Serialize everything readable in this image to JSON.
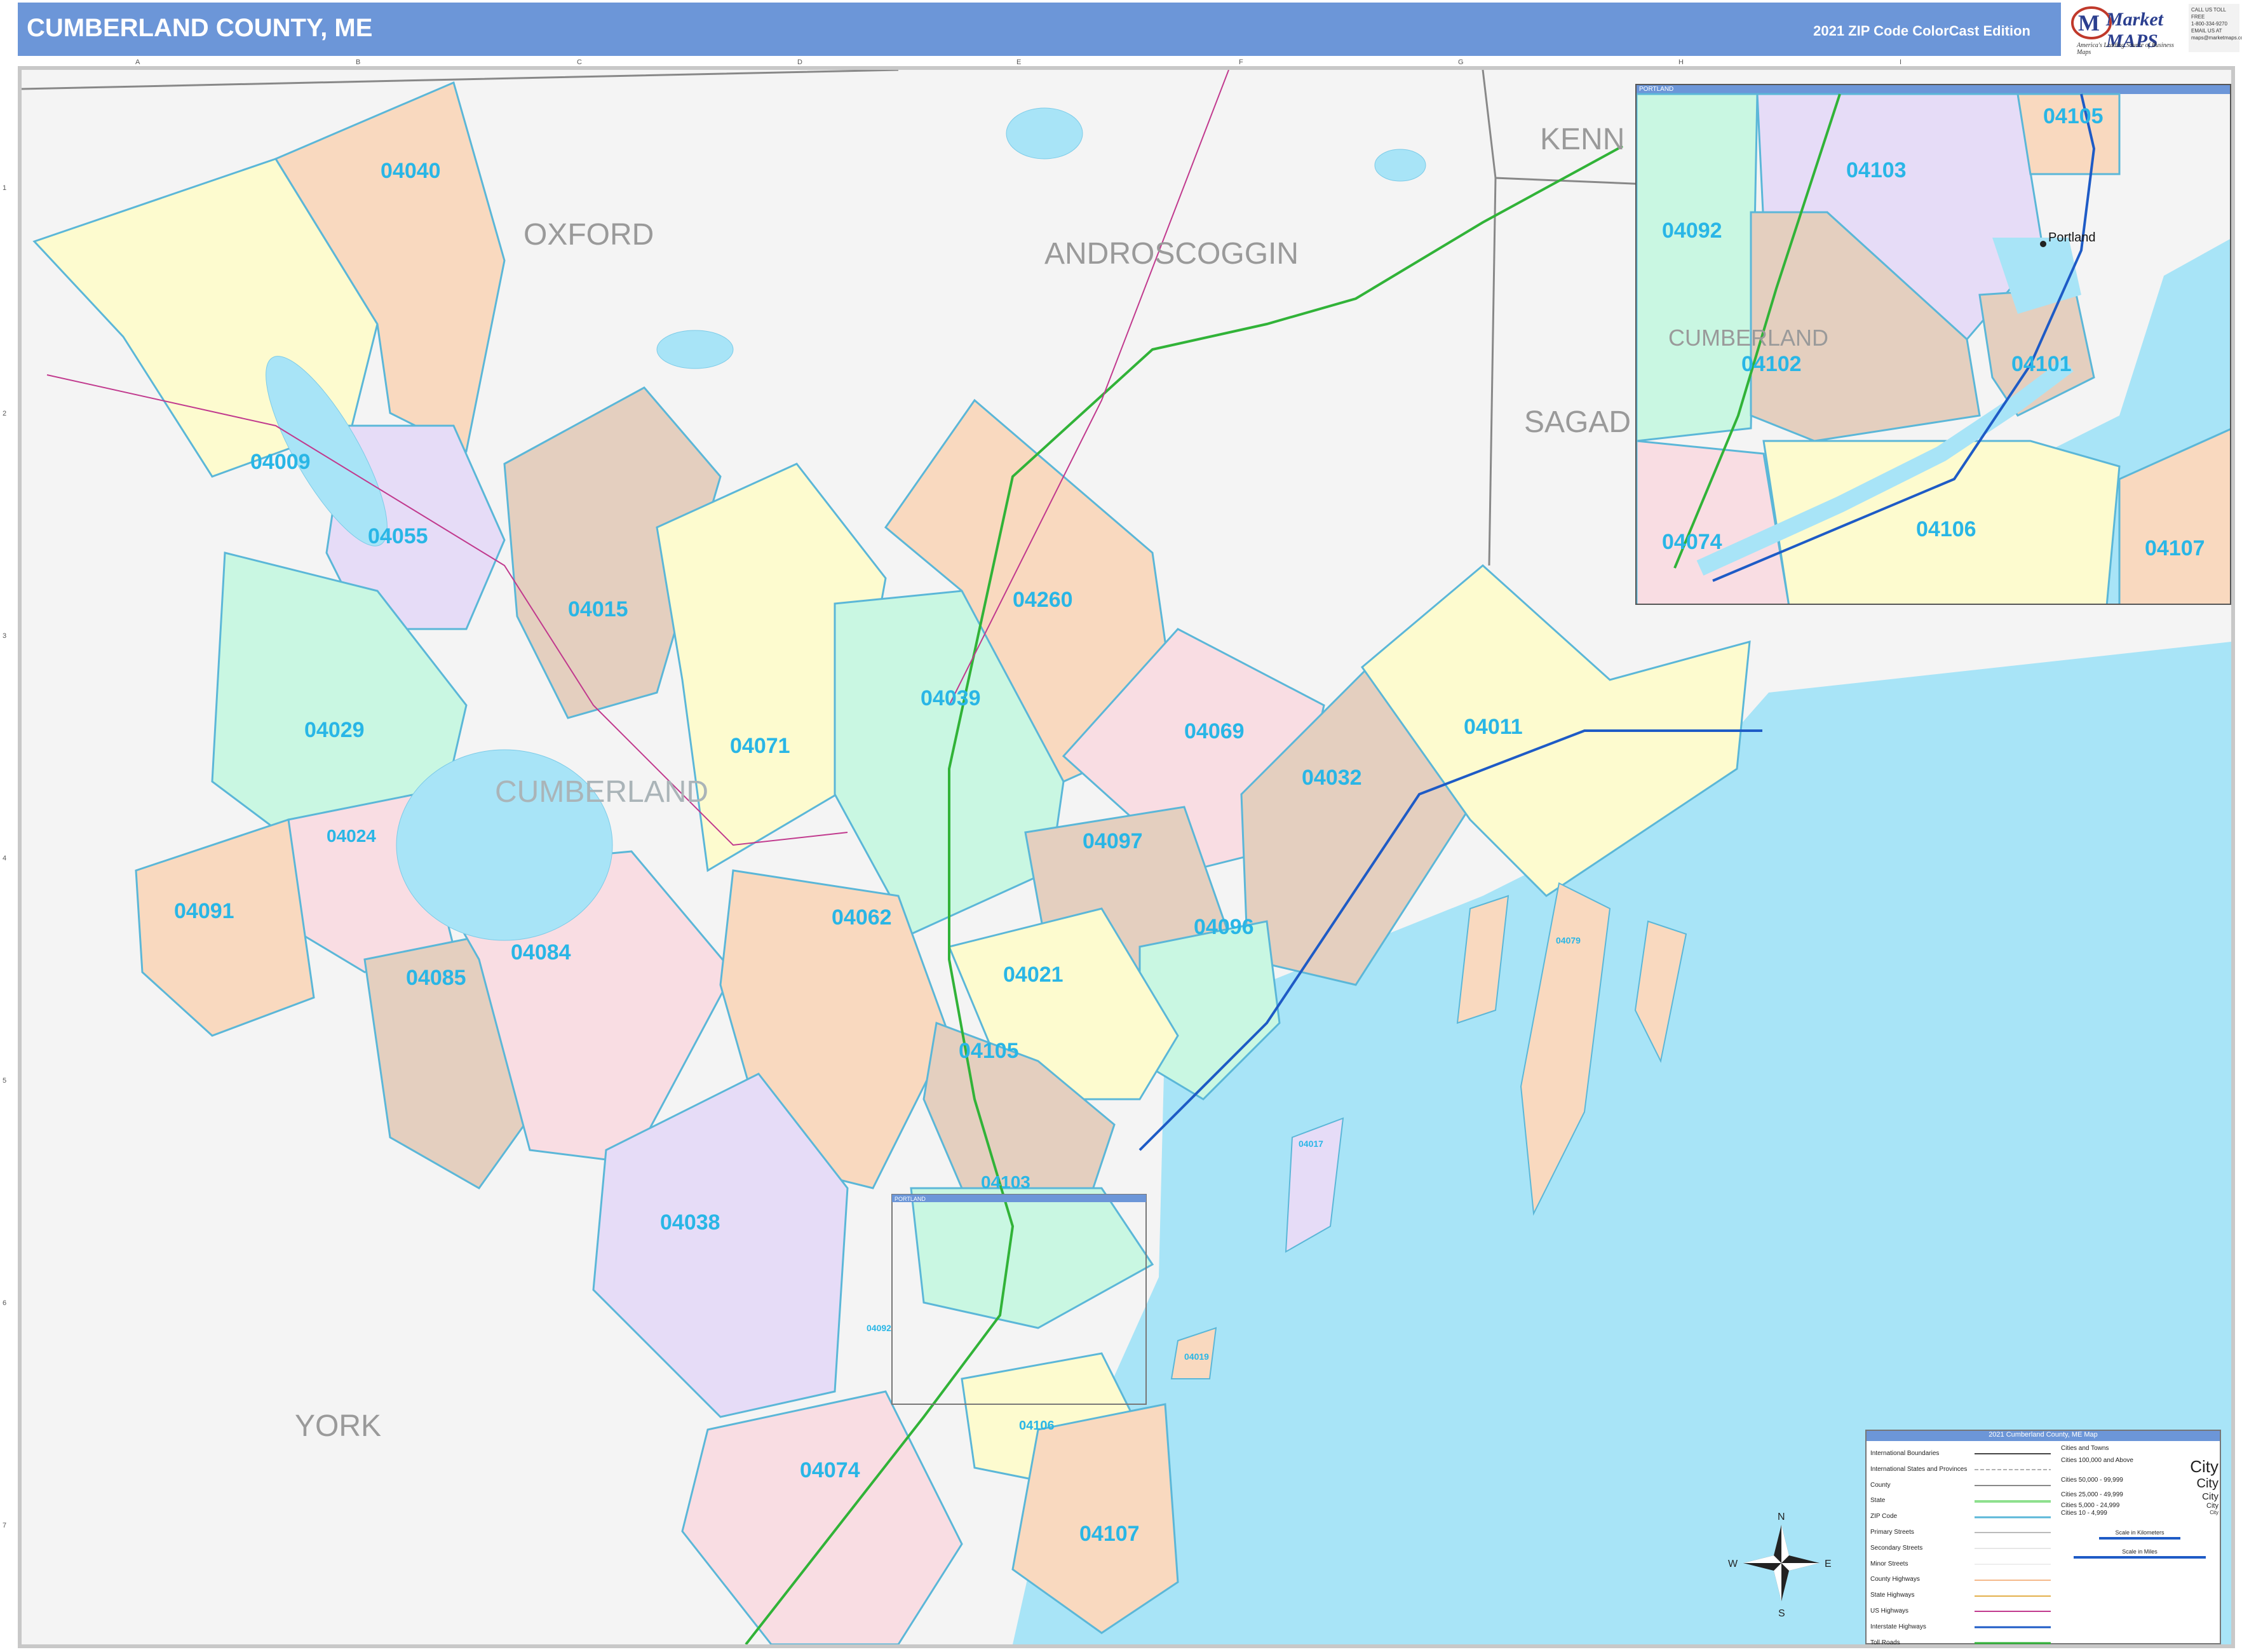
{
  "header": {
    "title": "CUMBERLAND COUNTY, ME",
    "edition": "2021 ZIP Code ColorCast Edition"
  },
  "logo": {
    "brand": "Market MAPS",
    "tagline": "America's Leading Source of Business Maps",
    "contact": [
      "CALL US TOLL FREE",
      "1-800-334-9270",
      "EMAIL US AT",
      "maps@marketmaps.com"
    ]
  },
  "grid": {
    "columns": [
      "A",
      "B",
      "C",
      "D",
      "E",
      "F",
      "G",
      "H",
      "I"
    ],
    "rows": [
      "1",
      "2",
      "3",
      "4",
      "5",
      "6",
      "7"
    ]
  },
  "counties": {
    "oxford": "OXFORD",
    "androscoggin": "ANDROSCOGGIN",
    "cumberland": "CUMBERLAND",
    "york": "YORK",
    "kennebec": "KENN",
    "sagadahoc": "SAGAD"
  },
  "zips": {
    "z04040": "04040",
    "z04009": "04009",
    "z04055": "04055",
    "z04015": "04015",
    "z04029": "04029",
    "z04024": "04024",
    "z04091": "04091",
    "z04085": "04085",
    "z04084": "04084",
    "z04071": "04071",
    "z04039": "04039",
    "z04260": "04260",
    "z04069": "04069",
    "z04032": "04032",
    "z04011": "04011",
    "z04097": "04097",
    "z04062": "04062",
    "z04096": "04096",
    "z04021": "04021",
    "z04105": "04105",
    "z04038": "04038",
    "z04103": "04103",
    "z04074": "04074",
    "z04106": "04106",
    "z04107": "04107",
    "z04017": "04017",
    "z04019": "04019",
    "z04079": "04079",
    "z04092": "04092"
  },
  "inset": {
    "title": "PORTLAND",
    "city": "Portland",
    "county": "CUMBERLAND",
    "zips": {
      "z04105": "04105",
      "z04103": "04103",
      "z04092": "04092",
      "z04102": "04102",
      "z04101": "04101",
      "z04074": "04074",
      "z04106": "04106",
      "z04107": "04107"
    }
  },
  "small_inset_label": "PORTLAND",
  "compass": {
    "n": "N",
    "s": "S",
    "e": "E",
    "w": "W"
  },
  "legend": {
    "title": "2021 Cumberland County, ME Map",
    "rows": [
      "International Boundaries",
      "International States and Provinces",
      "County",
      "State",
      "ZIP Code",
      "Primary Streets",
      "Secondary Streets",
      "Minor Streets",
      "County Highways",
      "State Highways",
      "US Highways",
      "Interstate Highways",
      "Toll Roads"
    ],
    "cities_heading": "Cities and Towns",
    "cities": [
      {
        "label": "Cities 100,000 and Above",
        "sample": "City"
      },
      {
        "label": "Cities 50,000 - 99,999",
        "sample": "City"
      },
      {
        "label": "Cities 25,000 - 49,999",
        "sample": "City"
      },
      {
        "label": "Cities 5,000 - 24,999",
        "sample": "City"
      },
      {
        "label": "Cities 10 - 4,999",
        "sample": "City"
      }
    ],
    "scale_km": "Scale in Kilometers",
    "scale_mi": "Scale in Miles"
  },
  "colors": {
    "header": "#6c96d8",
    "water": "#a8e4f7",
    "land": "#f4f4f4",
    "zip_text": "#29b6e6",
    "county_text": "#9a9a9a",
    "peach": "#f9d9bf",
    "yellow": "#fdfbcf",
    "lavender": "#e6dcf7",
    "taupe": "#e4cfbf",
    "mint": "#c9f7e2",
    "pink": "#f9dde3"
  }
}
